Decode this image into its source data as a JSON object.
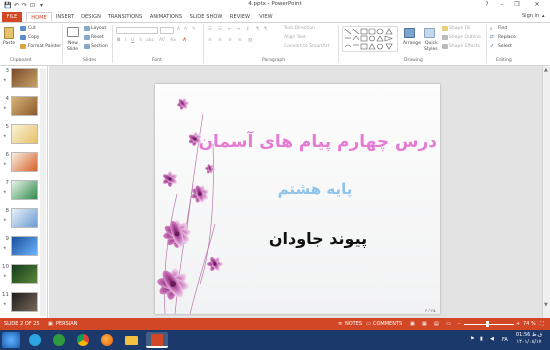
{
  "window": {
    "title": "4.pptx - PowerPoint",
    "controls": {
      "help": "?",
      "minimize": "–",
      "restore": "❐",
      "close": "✕"
    }
  },
  "quick_access": {
    "save": "💾",
    "undo": "↶",
    "redo": "↷",
    "start": "⊡",
    "more": "▾"
  },
  "tabs": [
    "FILE",
    "HOME",
    "INSERT",
    "DESIGN",
    "TRANSITIONS",
    "ANIMATIONS",
    "SLIDE SHOW",
    "REVIEW",
    "VIEW"
  ],
  "active_tab": "HOME",
  "user": {
    "sign_in": "Sign in"
  },
  "ribbon": {
    "clipboard": {
      "label": "Clipboard",
      "paste": "Paste",
      "cut": "Cut",
      "copy": "Copy",
      "format_painter": "Format Painter"
    },
    "slides": {
      "label": "Slides",
      "new_slide": "New",
      "new_slide_2": "Slide",
      "layout": "Layout",
      "reset": "Reset",
      "section": "Section"
    },
    "font": {
      "label": "Font"
    },
    "paragraph": {
      "label": "Paragraph",
      "text_direction": "Text Direction",
      "align_text": "Align Text",
      "convert_smartart": "Convert to SmartArt"
    },
    "drawing": {
      "label": "Drawing",
      "arrange": "Arrange",
      "quick_styles": "Quick",
      "quick_styles_2": "Styles",
      "shape_fill": "Shape Fill",
      "shape_outline": "Shape Outline",
      "shape_effects": "Shape Effects"
    },
    "editing": {
      "label": "Editing",
      "find": "Find",
      "replace": "Replace",
      "select": "Select"
    }
  },
  "slides_pane": {
    "slides": [
      {
        "num": "3",
        "colors": [
          "#7b4a2a",
          "#c9a36a"
        ]
      },
      {
        "num": "4",
        "colors": [
          "#d9b37a",
          "#8a5a2b"
        ]
      },
      {
        "num": "5",
        "colors": [
          "#fbf3d9",
          "#e6c067"
        ]
      },
      {
        "num": "6",
        "colors": [
          "#f7f0e0",
          "#d95f2a"
        ]
      },
      {
        "num": "7",
        "colors": [
          "#e8f4ea",
          "#2f8a4a"
        ]
      },
      {
        "num": "8",
        "colors": [
          "#e9f1fb",
          "#6a9bd1"
        ]
      },
      {
        "num": "9",
        "colors": [
          "#1a4f9c",
          "#6bb5ff"
        ]
      },
      {
        "num": "10",
        "colors": [
          "#143a1a",
          "#5a8a3a"
        ]
      },
      {
        "num": "11",
        "colors": [
          "#1d1d1d",
          "#7a6a5a"
        ]
      }
    ]
  },
  "slide": {
    "line1": "درس چهارم پیام های آسمان",
    "line2": "پایه هشتم",
    "line3": "پیوند جاودان",
    "colors": {
      "line1": "#e57bd3",
      "line2": "#8fc3ea",
      "line3": "#111111"
    },
    "footer": "۴ / ۲۵"
  },
  "status": {
    "slide": "SLIDE 2 OF 25",
    "language": "PERSIAN",
    "notes": "NOTES",
    "comments": "COMMENTS",
    "zoom": "74 %"
  },
  "taskbar": {
    "apps": [
      "start",
      "media-player",
      "chrome",
      "firefox",
      "explorer",
      "powerpoint"
    ],
    "lang": "FA",
    "time": "01:56 ق.ظ",
    "date": "۱۴۰۱/۰۸/۱۷"
  },
  "theme": {
    "accent": "#d24726",
    "taskbar": "#1b3a6b"
  }
}
